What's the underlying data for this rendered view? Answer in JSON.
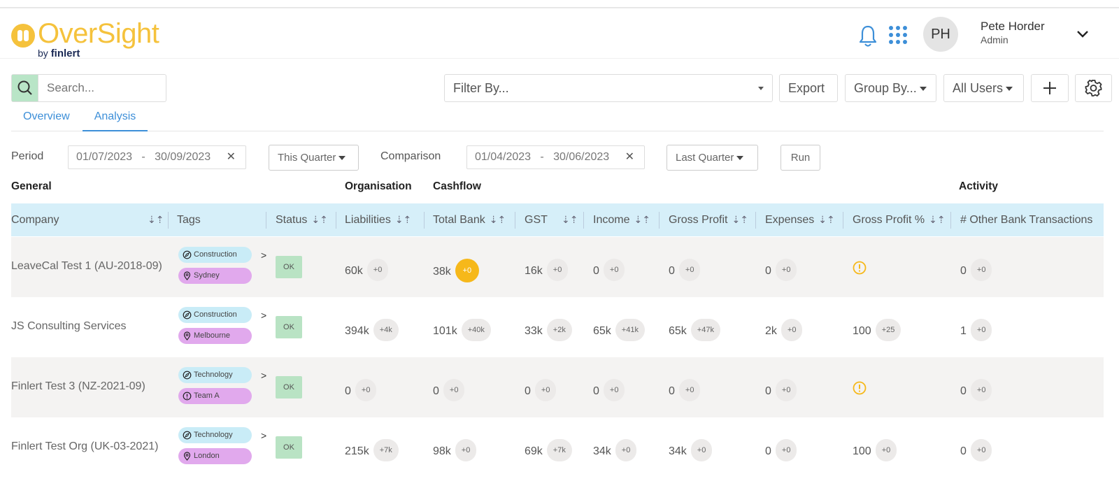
{
  "app": {
    "brand": "OverSight",
    "by": "by",
    "by_company": "finlert",
    "accent": "#f5c23c"
  },
  "user": {
    "initials": "PH",
    "name": "Pete Horder",
    "role": "Admin"
  },
  "toolbar": {
    "search_placeholder": "Search...",
    "filter_placeholder": "Filter By...",
    "export_label": "Export",
    "groupby_label": "Group By...",
    "allusers_label": "All Users"
  },
  "tabs": [
    {
      "label": "Overview",
      "active": false
    },
    {
      "label": "Analysis",
      "active": true
    }
  ],
  "period": {
    "label": "Period",
    "start": "01/07/2023",
    "end": "30/09/2023",
    "preset": "This Quarter",
    "comparison_label": "Comparison",
    "comp_start": "01/04/2023",
    "comp_end": "30/06/2023",
    "comp_preset": "Last Quarter",
    "run_label": "Run",
    "separator": "-"
  },
  "sections": {
    "general": "General",
    "organisation": "Organisation",
    "cashflow": "Cashflow",
    "activity": "Activity"
  },
  "columns": [
    "Company",
    "Tags",
    "Status",
    "Liabilities",
    "Total Bank",
    "GST",
    "Income",
    "Gross Profit",
    "Expenses",
    "Gross Profit %",
    "# Other Bank Transactions"
  ],
  "rows": [
    {
      "company": "LeaveCal Test 1 (AU-2018-09)",
      "tag1": "Construction",
      "tag2": "Sydney",
      "tag2_icon": "location-icon",
      "status": "OK",
      "liabilities": "60k",
      "liabilities_d": "+0",
      "bank": "38k",
      "bank_d": "+0",
      "gst": "16k",
      "gst_d": "+0",
      "income": "0",
      "income_d": "+0",
      "gp": "0",
      "gp_d": "+0",
      "expenses": "0",
      "expenses_d": "+0",
      "gpp": "",
      "gpp_d": "",
      "obt": "0",
      "obt_d": "+0"
    },
    {
      "company": "JS Consulting Services",
      "tag1": "Construction",
      "tag2": "Melbourne",
      "tag2_icon": "location-icon",
      "status": "OK",
      "liabilities": "394k",
      "liabilities_d": "+4k",
      "bank": "101k",
      "bank_d": "+40k",
      "gst": "33k",
      "gst_d": "+2k",
      "income": "65k",
      "income_d": "+41k",
      "gp": "65k",
      "gp_d": "+47k",
      "expenses": "2k",
      "expenses_d": "+0",
      "gpp": "100",
      "gpp_d": "+25",
      "obt": "1",
      "obt_d": "+0"
    },
    {
      "company": "Finlert Test 3 (NZ-2021-09)",
      "tag1": "Technology",
      "tag2": "Team A",
      "tag2_icon": "alert-icon",
      "status": "OK",
      "liabilities": "0",
      "liabilities_d": "+0",
      "bank": "0",
      "bank_d": "+0",
      "gst": "0",
      "gst_d": "+0",
      "income": "0",
      "income_d": "+0",
      "gp": "0",
      "gp_d": "+0",
      "expenses": "0",
      "expenses_d": "+0",
      "gpp": "",
      "gpp_d": "",
      "obt": "0",
      "obt_d": "+0"
    },
    {
      "company": "Finlert Test Org (UK-03-2021)",
      "tag1": "Technology",
      "tag2": "London",
      "tag2_icon": "location-icon",
      "status": "OK",
      "liabilities": "215k",
      "liabilities_d": "+7k",
      "bank": "98k",
      "bank_d": "+0",
      "gst": "69k",
      "gst_d": "+7k",
      "income": "34k",
      "income_d": "+0",
      "gp": "34k",
      "gp_d": "+0",
      "expenses": "0",
      "expenses_d": "+0",
      "gpp": "100",
      "gpp_d": "+0",
      "obt": "0",
      "obt_d": "+0"
    }
  ]
}
